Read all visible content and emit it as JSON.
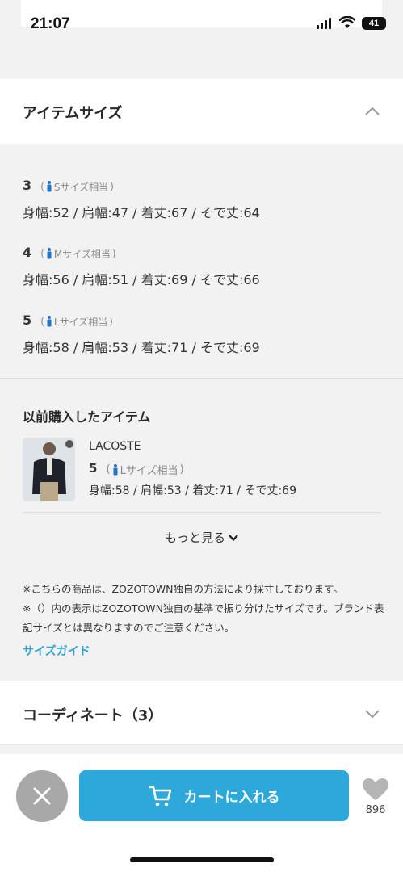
{
  "status": {
    "time": "21:07",
    "battery": "41"
  },
  "item_size": {
    "title": "アイテムサイズ",
    "sizes": [
      {
        "num": "3",
        "tag": "Sサイズ相当",
        "meas": "身幅:52 / 肩幅:47 / 着丈:67 / そで丈:64"
      },
      {
        "num": "4",
        "tag": "Mサイズ相当",
        "meas": "身幅:56 / 肩幅:51 / 着丈:69 / そで丈:66"
      },
      {
        "num": "5",
        "tag": "Lサイズ相当",
        "meas": "身幅:58 / 肩幅:53 / 着丈:71 / そで丈:69"
      }
    ]
  },
  "previous": {
    "title": "以前購入したアイテム",
    "brand": "LACOSTE",
    "num": "5",
    "tag": "Lサイズ相当",
    "meas": "身幅:58 / 肩幅:53 / 着丈:71 / そで丈:69",
    "more": "もっと見る"
  },
  "notes": {
    "note1": "※こちらの商品は、ZOZOTOWN独自の方法により採寸しております。",
    "note2": "※（）内の表示はZOZOTOWN独自の基準で振り分けたサイズです。ブランド表記サイズとは異なりますのでご注意ください。",
    "guide": "サイズガイド"
  },
  "coordinate": {
    "title": "コーディネート（3）"
  },
  "bottom": {
    "cart_label": "カートに入れる",
    "fav_count": "896"
  },
  "colors": {
    "accent": "#2ea7db",
    "link": "#2ea2d6",
    "person_icon": "#1f73c8"
  }
}
